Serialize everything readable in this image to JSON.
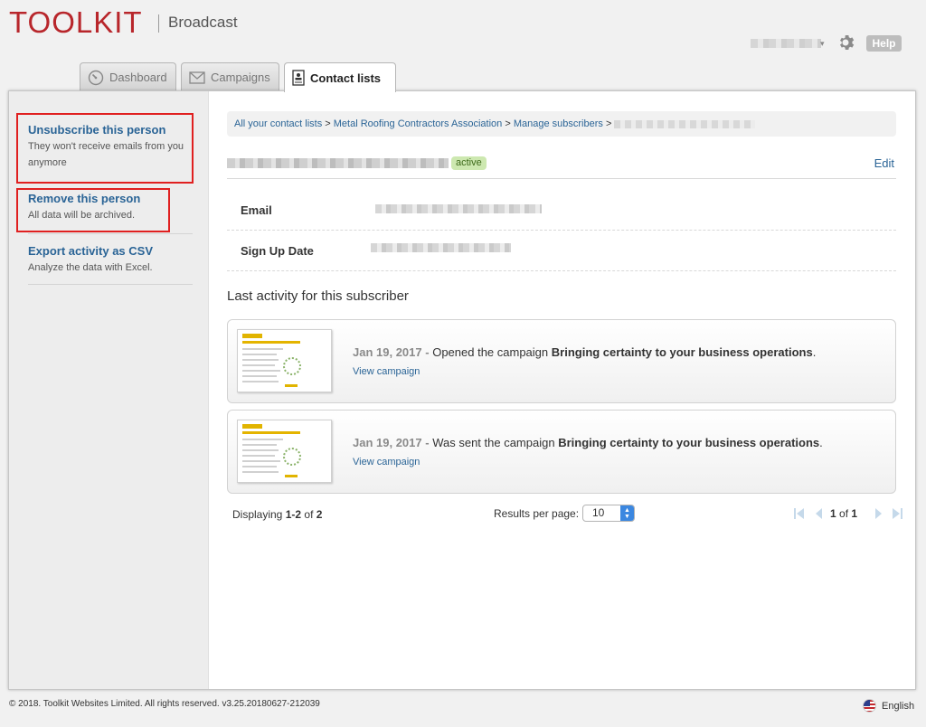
{
  "header": {
    "logo": "TOOLKIT",
    "product": "Broadcast",
    "help": "Help"
  },
  "tabs": [
    {
      "label": "Dashboard",
      "icon": "dashboard-icon"
    },
    {
      "label": "Campaigns",
      "icon": "envelope-icon"
    },
    {
      "label": "Contact lists",
      "icon": "contact-card-icon",
      "active": true
    }
  ],
  "sidebar": {
    "items": [
      {
        "title": "Unsubscribe this person",
        "desc": "They won't receive emails from you anymore"
      },
      {
        "title": "Remove this person",
        "desc": "All data will be archived."
      },
      {
        "title": "Export activity as CSV",
        "desc": "Analyze the data with Excel."
      }
    ]
  },
  "breadcrumb": {
    "items": [
      "All your contact lists",
      "Metal Roofing Contractors Association",
      "Manage subscribers"
    ],
    "sep": ">"
  },
  "subscriber": {
    "status": "active",
    "edit": "Edit",
    "fields": [
      {
        "label": "Email"
      },
      {
        "label": "Sign Up Date"
      }
    ]
  },
  "activity": {
    "title": "Last activity for this subscriber",
    "items": [
      {
        "date": "Jan 19, 2017",
        "action": "Opened the campaign",
        "campaign": "Bringing certainty to your business operations",
        "link": "View campaign"
      },
      {
        "date": "Jan 19, 2017",
        "action": "Was sent the campaign",
        "campaign": "Bringing certainty to your business operations",
        "link": "View campaign"
      }
    ]
  },
  "pagination": {
    "displaying_prefix": "Displaying",
    "range": "1-2",
    "of_word": "of",
    "total": "2",
    "rpp_label": "Results per page:",
    "rpp_value": "10",
    "page": "1",
    "pages": "1"
  },
  "footer": {
    "copyright": "© 2018. Toolkit Websites Limited. All rights reserved. v3.25.20180627-212039",
    "language": "English"
  },
  "colors": {
    "brand": "#b8262b",
    "link": "#2a6496",
    "highlight": "#e02020",
    "badge_bg": "#cde8b0"
  }
}
